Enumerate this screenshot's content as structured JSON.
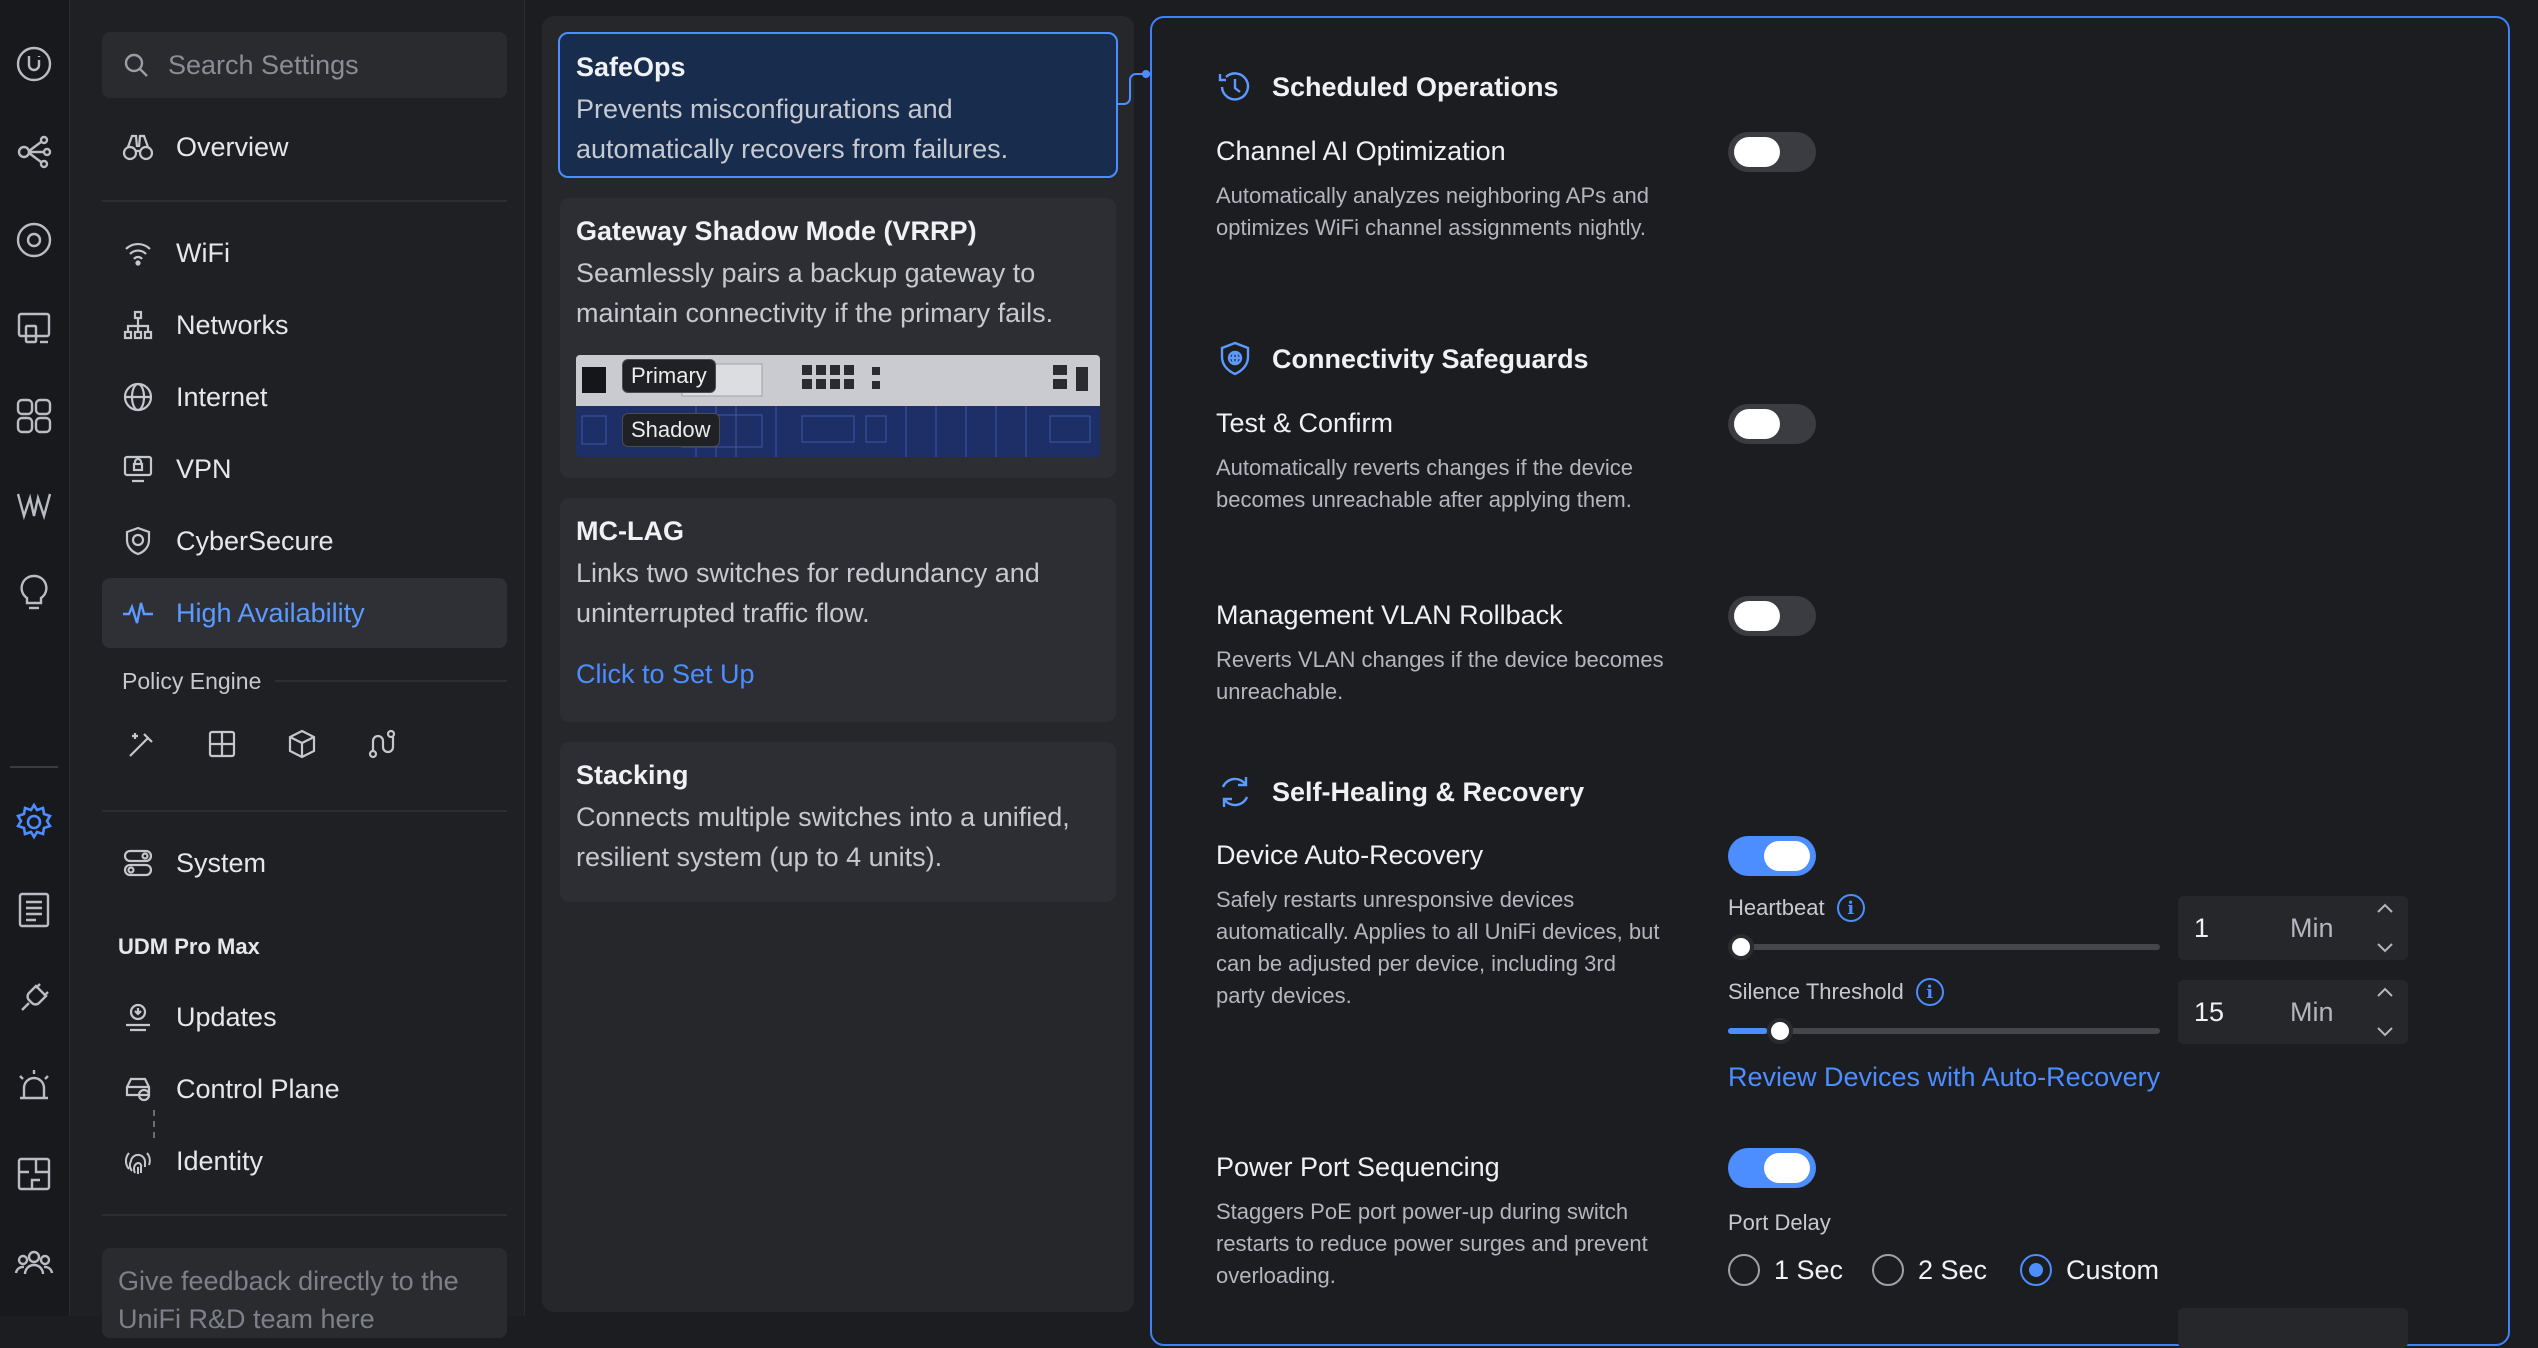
{
  "rail": {
    "items": [
      "unifi-logo",
      "topology",
      "insights",
      "devices",
      "clients",
      "radio-manager",
      "ideas",
      "settings",
      "logs",
      "integrations",
      "alarm",
      "floorplan",
      "users"
    ]
  },
  "nav": {
    "search_placeholder": "Search Settings",
    "items": [
      {
        "label": "Overview"
      },
      {
        "label": "WiFi"
      },
      {
        "label": "Networks"
      },
      {
        "label": "Internet"
      },
      {
        "label": "VPN"
      },
      {
        "label": "CyberSecure"
      },
      {
        "label": "High Availability"
      }
    ],
    "policy_engine_label": "Policy Engine",
    "system_label": "System",
    "device_heading": "UDM Pro Max",
    "device_items": [
      {
        "label": "Updates"
      },
      {
        "label": "Control Plane"
      },
      {
        "label": "Identity"
      }
    ],
    "feedback_text": "Give feedback directly to the UniFi R&D team here"
  },
  "features": [
    {
      "title": "SafeOps",
      "desc": "Prevents misconfigurations and automatically recovers from failures."
    },
    {
      "title": "Gateway Shadow Mode (VRRP)",
      "desc": "Seamlessly pairs a backup gateway to maintain connectivity if the primary fails.",
      "tag_primary": "Primary",
      "tag_shadow": "Shadow"
    },
    {
      "title": "MC-LAG",
      "desc": "Links two switches for redundancy and uninterrupted traffic flow.",
      "link": "Click to Set Up"
    },
    {
      "title": "Stacking",
      "desc": "Connects multiple switches into a unified, resilient system (up to 4 units)."
    }
  ],
  "safeops": {
    "sections": [
      {
        "title": "Scheduled Operations"
      },
      {
        "title": "Connectivity Safeguards"
      },
      {
        "title": "Self-Healing & Recovery"
      }
    ],
    "settings": [
      {
        "title": "Channel AI Optimization",
        "desc": "Automatically analyzes neighboring APs and optimizes WiFi channel assignments nightly.",
        "enabled": false
      },
      {
        "title": "Test & Confirm",
        "desc": "Automatically reverts changes if the device becomes unreachable after applying them.",
        "enabled": false
      },
      {
        "title": "Management VLAN Rollback",
        "desc": "Reverts VLAN changes if the device becomes unreachable.",
        "enabled": false
      },
      {
        "title": "Device Auto-Recovery",
        "desc": "Safely restarts unresponsive devices automatically. Applies to all UniFi devices, but can be adjusted per device, including 3rd party devices.",
        "enabled": true
      },
      {
        "title": "Power Port Sequencing",
        "desc": "Staggers PoE port power-up during switch restarts to reduce power surges and prevent overloading.",
        "enabled": true
      }
    ],
    "heartbeat": {
      "label": "Heartbeat",
      "value": "1",
      "unit": "Min",
      "level": 0.0
    },
    "silence": {
      "label": "Silence Threshold",
      "value": "15",
      "unit": "Min",
      "level": 0.09
    },
    "review_link": "Review Devices with Auto-Recovery",
    "port_delay": {
      "label": "Port Delay",
      "options": [
        "1 Sec",
        "2 Sec",
        "Custom"
      ],
      "selected": "Custom"
    }
  },
  "colors": {
    "accent": "#4c8dff",
    "background": "#1c1d20"
  }
}
